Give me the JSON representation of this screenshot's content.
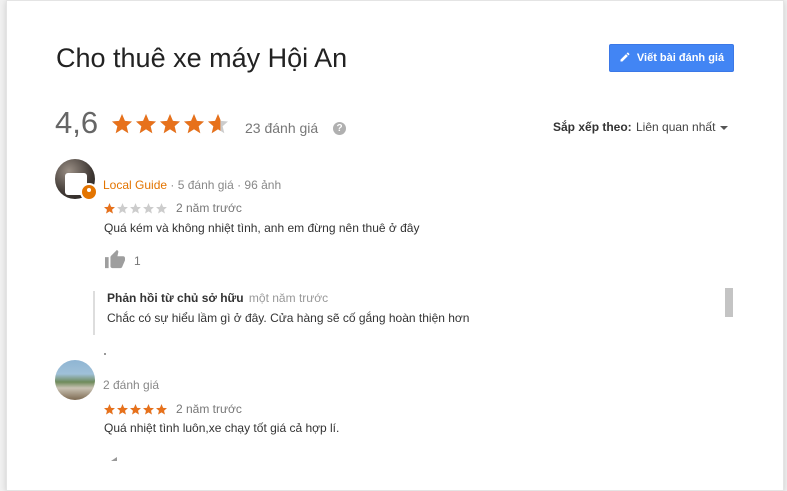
{
  "dialog": {
    "title": "Cho thuê xe máy Hội An",
    "write_review_label": "Viết bài đánh giá"
  },
  "summary": {
    "rating": "4,6",
    "rating_value": 4.6,
    "review_count_label": "23 đánh giá",
    "help_glyph": "?",
    "sort_label": "Sắp xếp theo:",
    "sort_value": "Liên quan nhất"
  },
  "reviews": [
    {
      "local_guide_label": "Local Guide",
      "meta": "· 5 đánh giá · 96 ảnh",
      "stars": 1,
      "when": "2 năm trước",
      "text": "Quá kém và không nhiệt tình, anh em đừng nên thuê ở đây",
      "likes": "1",
      "owner_reply": {
        "heading": "Phản hồi từ chủ sở hữu",
        "when": "một năm trước",
        "text": "Chắc có sự hiểu lầm gì ở đây. Cửa hàng sẽ cố gắng hoàn thiện hơn"
      }
    },
    {
      "meta": "2 đánh giá",
      "stars": 5,
      "when": "2 năm trước",
      "text": "Quá nhiệt tình luôn,xe chạy tốt giá cả hợp lí."
    }
  ],
  "colors": {
    "star_filled": "#e7711b",
    "star_empty": "#cccccc",
    "button_blue": "#4285f4",
    "local_guide_orange": "#e37400"
  }
}
